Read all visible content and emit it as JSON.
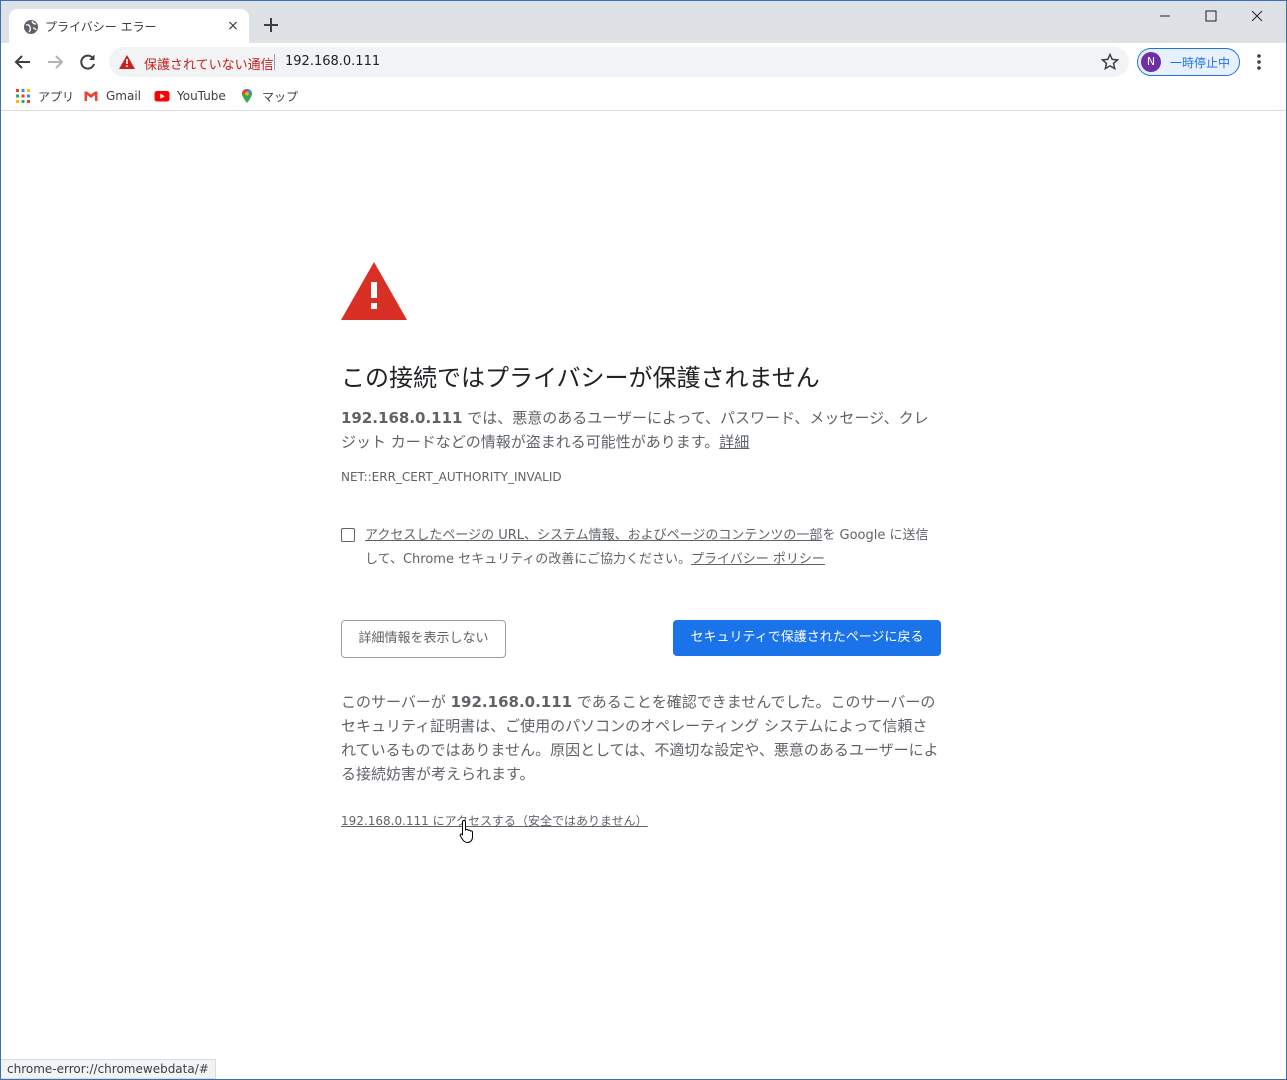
{
  "tab": {
    "title": "プライバシー エラー",
    "close": "×"
  },
  "toolbar": {
    "security_label": "保護されていない通信",
    "url": "192.168.0.111",
    "profile_initial": "N",
    "profile_label": "一時停止中"
  },
  "bookmarks": [
    {
      "label": "アプリ",
      "icon": "apps-grid-icon"
    },
    {
      "label": "Gmail",
      "icon": "gmail-icon"
    },
    {
      "label": "YouTube",
      "icon": "youtube-icon"
    },
    {
      "label": "マップ",
      "icon": "maps-pin-icon"
    }
  ],
  "page": {
    "heading": "この接続ではプライバシーが保護されません",
    "host": "192.168.0.111",
    "desc_text": " では、悪意のあるユーザーによって、パスワード、メッセージ、クレジット カードなどの情報が盗まれる可能性があります。",
    "desc_link": "詳細",
    "error_code": "NET::ERR_CERT_AUTHORITY_INVALID",
    "optin_link1": "アクセスしたページの URL、システム情報、およびページのコンテンツの一部",
    "optin_text": "を Google に送信して、Chrome セキュリティの改善にご協力ください。",
    "optin_link2": "プライバシー ポリシー",
    "hide_details_button": "詳細情報を表示しない",
    "back_button": "セキュリティで保護されたページに戻る",
    "details_pre": "このサーバーが ",
    "details_post": " であることを確認できませんでした。このサーバーのセキュリティ証明書は、ご使用のパソコンのオペレーティング システムによって信頼されているものではありません。原因としては、不適切な設定や、悪意のあるユーザーによる接続妨害が考えられます。",
    "proceed_link": "192.168.0.111 にアクセスする（安全ではありません）"
  },
  "status_bar": "chrome-error://chromewebdata/#",
  "colors": {
    "accent": "#1a73e8",
    "danger": "#d93025",
    "text": "#5f6368"
  }
}
